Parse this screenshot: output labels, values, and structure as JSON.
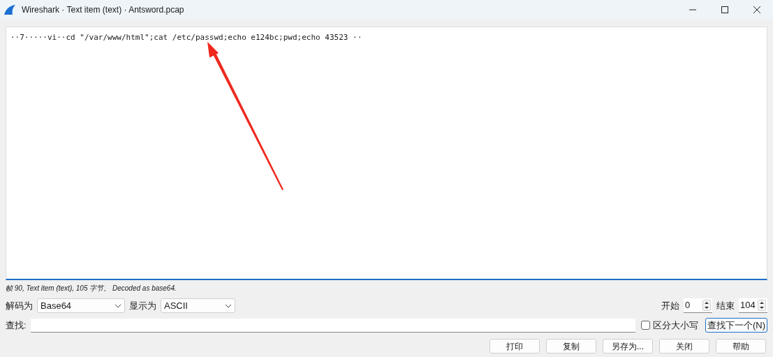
{
  "window": {
    "title": "Wireshark · Text item (text) · Antsword.pcap"
  },
  "content": {
    "text": "··7·····vi··cd \"/var/www/html\";cat /etc/passwd;echo e124bc;pwd;echo 43523 ··"
  },
  "status": "帧 90, Text item (text), 105 字节。 Decoded as base64.",
  "decode": {
    "label": "解码为",
    "value": "Base64"
  },
  "show": {
    "label": "显示为",
    "value": "ASCII"
  },
  "start": {
    "label": "开始",
    "value": "0"
  },
  "end": {
    "label": "结束",
    "value": "104"
  },
  "find": {
    "label": "查找:",
    "case_label": "区分大小写",
    "case_checked": false,
    "next_button": "查找下一个(N)"
  },
  "buttons": [
    "打印",
    "复制",
    "另存为...",
    "关闭",
    "帮助"
  ]
}
